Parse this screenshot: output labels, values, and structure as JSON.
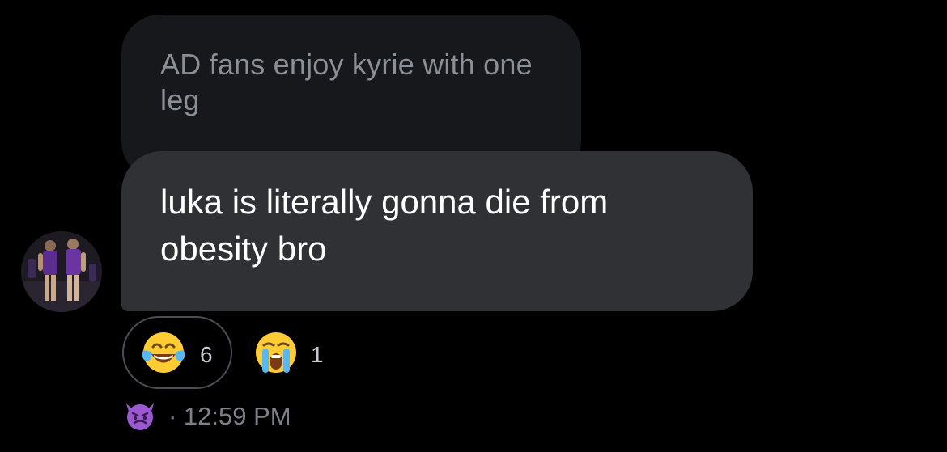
{
  "messages": {
    "quoted_text": "AD fans enjoy kyrie with one leg",
    "main_text": "luka is literally gonna die from obesity bro"
  },
  "avatar": {
    "icon": "user-avatar-basketball-photo"
  },
  "reactions": [
    {
      "icon": "face-with-tears-of-joy",
      "count": "6",
      "selected": true
    },
    {
      "icon": "loudly-crying-face",
      "count": "1",
      "selected": false
    }
  ],
  "meta": {
    "status_icon": "smiling-face-with-horns",
    "timestamp": "· 12:59 PM"
  },
  "colors": {
    "background": "#000000",
    "quoted_bubble": "#17181c",
    "main_bubble": "#2f3135",
    "muted_text": "#8b8f96"
  }
}
